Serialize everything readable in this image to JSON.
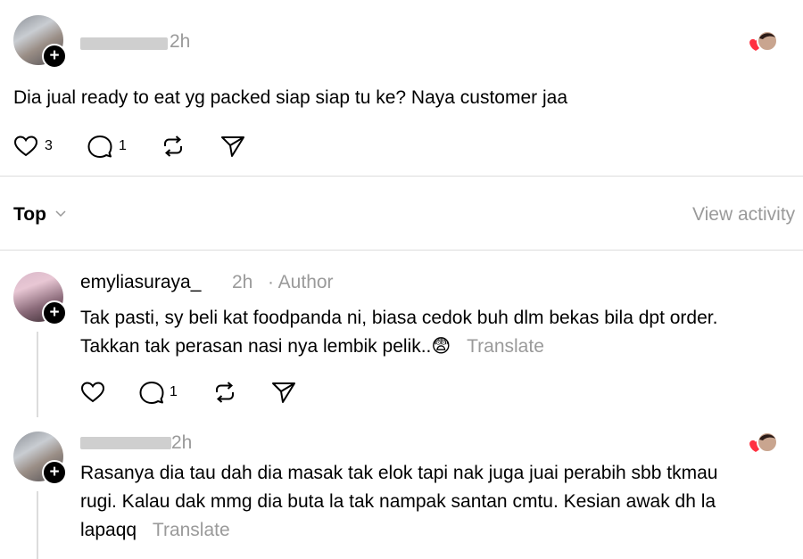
{
  "post": {
    "username_visible": "",
    "time": "2h",
    "text": "Dia jual ready to eat yg packed siap siap tu ke? Naya customer jaa",
    "likes": "3",
    "replies": "1"
  },
  "sort": {
    "label": "Top",
    "view_activity": "View activity"
  },
  "replies": [
    {
      "username": "emyliasuraya_",
      "time": "2h",
      "role": "· Author",
      "line1": "Tak pasti, sy beli kat foodpanda ni, biasa cedok buh dlm bekas bila dpt order.",
      "line2": "Takkan tak perasan nasi nya lembik pelik..😨",
      "translate": "Translate",
      "replies": "1"
    },
    {
      "username_visible": "",
      "time": "2h",
      "line1": "Rasanya dia tau dah dia masak tak elok tapi nak juga juai perabih sbb tkmau",
      "line2": "rugi. Kalau dak mmg dia buta la tak nampak santan cmtu. Kesian awak dh la",
      "line3": "lapaqq",
      "translate": "Translate"
    }
  ],
  "icons": {
    "plus": "+",
    "chevron": "⌄"
  },
  "colors": {
    "like_heart": "#ff3040",
    "muted_text": "#9a9a9a",
    "divider": "#dcdcdc"
  }
}
